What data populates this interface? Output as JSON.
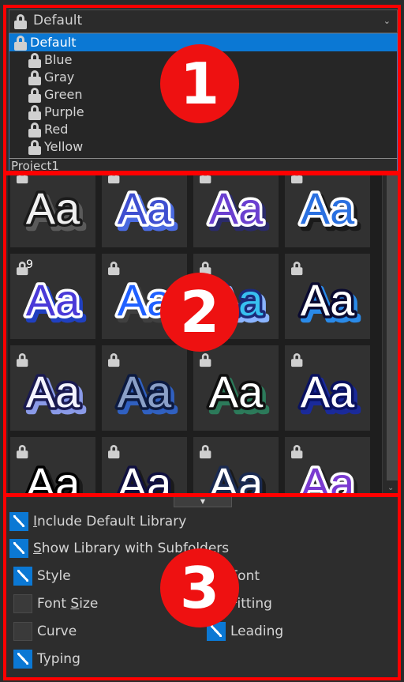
{
  "library": {
    "selected": "Default",
    "options": [
      {
        "label": "Default",
        "selected": true
      },
      {
        "label": "Blue"
      },
      {
        "label": "Gray"
      },
      {
        "label": "Green"
      },
      {
        "label": "Purple"
      },
      {
        "label": "Red"
      },
      {
        "label": "Yellow"
      }
    ],
    "project": "Project1"
  },
  "grid": {
    "preview_text": "Aa",
    "first_cell_number": "9",
    "styles": [
      {
        "fill": "#f0f0f0",
        "stroke": "#1a1a1a",
        "shadow": "#5a5a5a"
      },
      {
        "fill": "#3f4fd0",
        "stroke": "#ffffff",
        "shadow": "#4a6ae0"
      },
      {
        "fill": "#6a3fd0",
        "stroke": "#ffffff",
        "shadow": "#2a2a6a"
      },
      {
        "fill": "#2a70e0",
        "stroke": "#ffffff",
        "shadow": "#1a1a1a"
      },
      {
        "fill": "#4a3ad8",
        "stroke": "#ffffff",
        "shadow": "#2040c0"
      },
      {
        "fill": "#2060ff",
        "stroke": "#ffffff",
        "shadow": "#404040"
      },
      {
        "fill": "#38c0f0",
        "stroke": "#1c2a78",
        "shadow": "#8ab4ff"
      },
      {
        "fill": "#ffffff",
        "stroke": "#0a0a30",
        "shadow": "#2a8ae8"
      },
      {
        "fill": "#f4f4ff",
        "stroke": "#1a1a50",
        "shadow": "#8a9ae8"
      },
      {
        "fill": "#8aa0c8",
        "stroke": "#0c1a40",
        "shadow": "#3060c0"
      },
      {
        "fill": "#ffffff",
        "stroke": "#101010",
        "shadow": "#2c7a5a"
      },
      {
        "fill": "#ffffff",
        "stroke": "#0a1260",
        "shadow": "#1a2a9a"
      },
      {
        "fill": "#ffffff",
        "stroke": "#000000",
        "shadow": "#1a1a1a"
      },
      {
        "fill": "#ffffff",
        "stroke": "#101040",
        "shadow": "#1a1a1a"
      },
      {
        "fill": "#ffffff",
        "stroke": "#1a2a50",
        "shadow": "#1a1a1a"
      },
      {
        "fill": "#7a3ad0",
        "stroke": "#ffffff",
        "shadow": "#202020"
      }
    ]
  },
  "options": {
    "include_default_library": {
      "label": "Include Default Library",
      "checked": true
    },
    "show_library_subfolders": {
      "label": "Show Library with Subfolders",
      "checked": true
    },
    "style": {
      "label": "Style",
      "checked": true
    },
    "font": {
      "label": "Font",
      "checked": false
    },
    "font_size": {
      "label": "Font Size",
      "checked": false
    },
    "fitting": {
      "label": "Fitting",
      "checked": false
    },
    "curve": {
      "label": "Curve",
      "checked": false
    },
    "leading": {
      "label": "Leading",
      "checked": true
    },
    "typing": {
      "label": "Typing",
      "checked": true
    }
  },
  "markers": [
    "1",
    "2",
    "3"
  ],
  "colors": {
    "highlight": "#0b78d4",
    "marker": "#ff0000"
  }
}
